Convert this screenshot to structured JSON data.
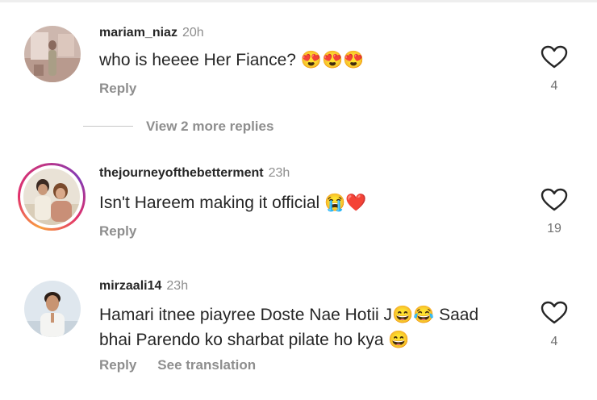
{
  "comments": [
    {
      "username": "mariam_niaz",
      "time": "20h",
      "text": "who is heeee Her Fiance? 😍😍😍",
      "reply_label": "Reply",
      "likes": "4",
      "avatar_ring": false
    },
    {
      "username": "thejourneyofthebetterment",
      "time": "23h",
      "text": "Isn't Hareem making it official 😭❤️",
      "reply_label": "Reply",
      "likes": "19",
      "avatar_ring": true
    },
    {
      "username": "mirzaali14",
      "time": "23h",
      "text_line1": "Hamari itnee piayree Doste Nae Hotii J😄😂 Saad",
      "text_line2": "bhai Parendo ko sharbat pilate ho kya 😄",
      "reply_label": "Reply",
      "translation_label": "See translation",
      "likes": "4",
      "avatar_ring": false
    }
  ],
  "view_more_replies": "View 2 more replies",
  "icons": {
    "like": "heart-outline-icon"
  },
  "colors": {
    "text": "#262626",
    "secondary": "#8e8e8e",
    "ring_start": "#f9a03f",
    "ring_end": "#c13584"
  }
}
